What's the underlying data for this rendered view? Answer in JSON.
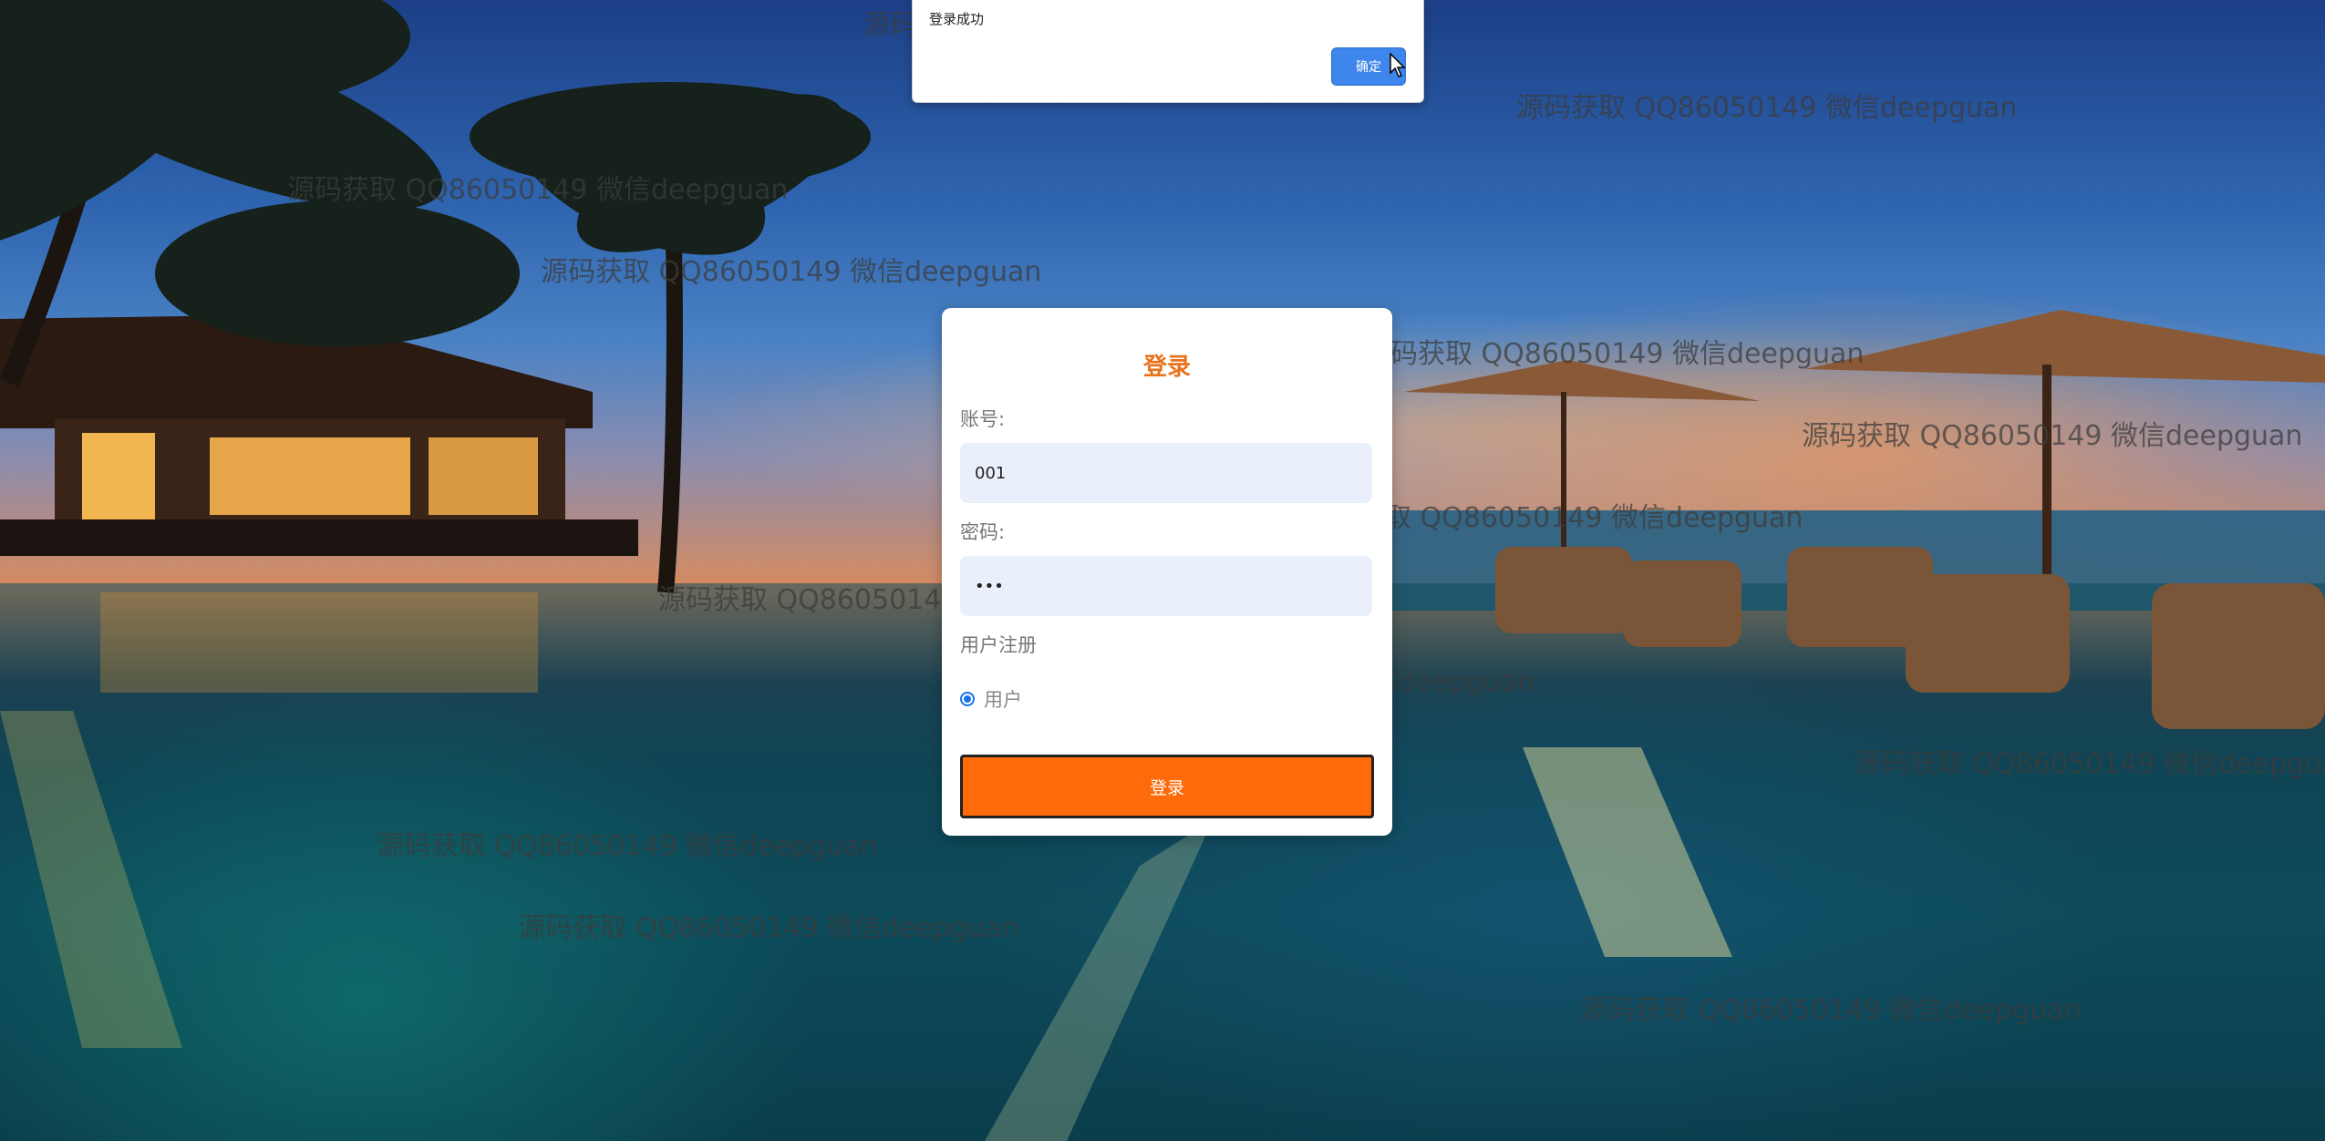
{
  "alert": {
    "message": "登录成功",
    "ok_label": "确定"
  },
  "login": {
    "title": "登录",
    "account_label": "账号:",
    "account_value": "001",
    "password_label": "密码:",
    "password_value": "•••",
    "register_label": "用户注册",
    "role_option": "用户",
    "submit_label": "登录"
  },
  "watermark": {
    "text": "源码获取 QQ86050149 微信deepguan"
  }
}
